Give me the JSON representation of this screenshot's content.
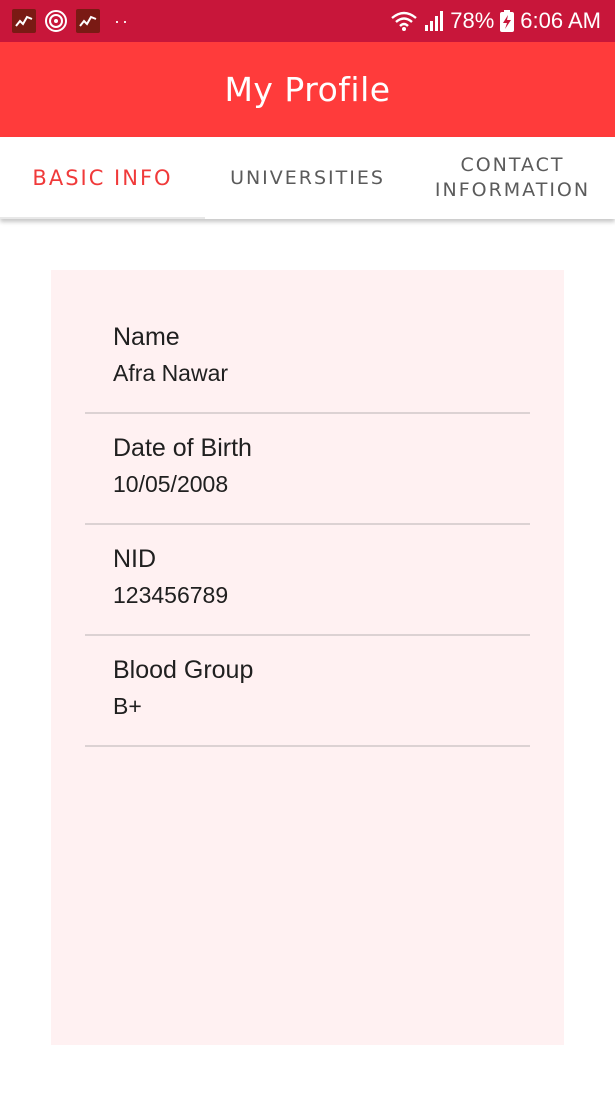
{
  "status_bar": {
    "battery": "78%",
    "time": "6:06 AM",
    "dots": "··",
    "icons": [
      "stock-chart-icon",
      "ring-logo-icon",
      "stock-chart-icon",
      "wifi-icon",
      "signal-icon",
      "battery-charging-icon"
    ]
  },
  "app_bar": {
    "title": "My Profile",
    "color": "#ff3b3b"
  },
  "tabs": [
    {
      "label": "BASIC INFO",
      "active": true
    },
    {
      "label": "UNIVERSITIES",
      "active": false
    },
    {
      "label": "CONTACT INFORMATION",
      "active": false
    }
  ],
  "fields": [
    {
      "label": "Name",
      "value": "Afra Nawar"
    },
    {
      "label": "Date of Birth",
      "value": "10/05/2008"
    },
    {
      "label": "NID",
      "value": "123456789"
    },
    {
      "label": "Blood Group",
      "value": "B+"
    }
  ],
  "colors": {
    "status_bar": "#c8163a",
    "accent": "#f03a3a",
    "card_background": "#fff1f2"
  }
}
